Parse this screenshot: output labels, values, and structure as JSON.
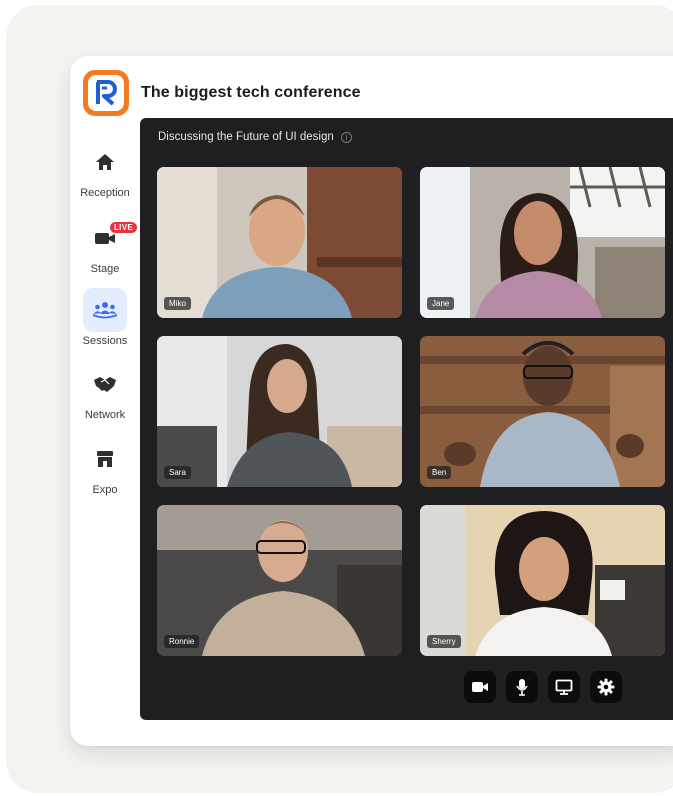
{
  "app": {
    "title": "The biggest tech conference",
    "logo_letter": "R",
    "brand_color": "#f47a1f"
  },
  "nav": {
    "items": [
      {
        "label": "Reception",
        "icon": "home-icon",
        "active": false
      },
      {
        "label": "Stage",
        "icon": "camera-icon",
        "badge": "LIVE",
        "active": false
      },
      {
        "label": "Sessions",
        "icon": "people-icon",
        "active": true
      },
      {
        "label": "Network",
        "icon": "handshake-icon",
        "active": false
      },
      {
        "label": "Expo",
        "icon": "storefront-icon",
        "active": false
      }
    ]
  },
  "session": {
    "title": "Discussing the Future of UI design",
    "info_icon": "info-icon"
  },
  "participants": [
    {
      "name": "Miko"
    },
    {
      "name": "Jane"
    },
    {
      "name": "Sara"
    },
    {
      "name": "Ben"
    },
    {
      "name": "Ronnie"
    },
    {
      "name": "Sherry"
    }
  ],
  "controls": [
    {
      "icon": "video-camera-icon"
    },
    {
      "icon": "microphone-icon"
    },
    {
      "icon": "screen-share-icon"
    },
    {
      "icon": "settings-gear-icon"
    }
  ],
  "colors": {
    "accent": "#3b6df0",
    "live": "#e8333f",
    "stage_bg": "#1f1f21"
  }
}
